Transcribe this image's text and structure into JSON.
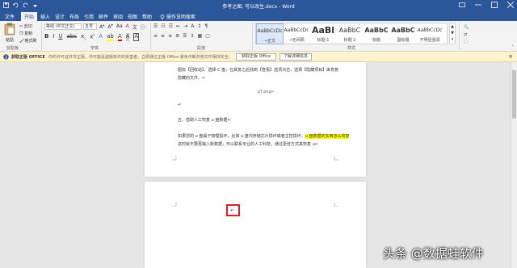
{
  "titlebar": {
    "doc_title": "参考之图, 可以改生.docx - Word"
  },
  "tabs": [
    {
      "label": "文件"
    },
    {
      "label": "开始"
    },
    {
      "label": "插入"
    },
    {
      "label": "设计"
    },
    {
      "label": "布局"
    },
    {
      "label": "引用"
    },
    {
      "label": "邮件"
    },
    {
      "label": "审阅"
    },
    {
      "label": "视图"
    },
    {
      "label": "帮助"
    }
  ],
  "tell_me": "操作说明搜索",
  "ribbon": {
    "paste_label": "粘贴",
    "cut_label": "剪切",
    "copy_label": "复制",
    "format_painter_label": "格式刷",
    "font_name": "等线 (中文正文)",
    "font_size": "五号",
    "groups": {
      "clipboard": "剪贴板",
      "font": "字体",
      "paragraph": "段落",
      "styles": "样式"
    },
    "styles": [
      {
        "sample": "AaBbCcDc",
        "name": "→正文"
      },
      {
        "sample": "AaBbCcDc",
        "name": "→无间隔"
      },
      {
        "sample": "AaBl",
        "name": "标题 1"
      },
      {
        "sample": "AaBbC",
        "name": "标题 2"
      },
      {
        "sample": "AaBbC",
        "name": "标题"
      },
      {
        "sample": "AaBbC",
        "name": "副标题"
      },
      {
        "sample": "AaBbCcDc",
        "name": "不明显强调"
      },
      {
        "sample": "AaBbCcDc",
        "name": "强调"
      }
    ]
  },
  "message_bar": {
    "title": "获取正版 OFFICE",
    "text": "你的许可证并非正版，你可能是盗版软件的受害者。立即通过正版 Office 避免中断并使文件保持安全。",
    "button1": "获取正版 Office",
    "button2": "了解详细信息"
  },
  "document": {
    "line1": "图标【回收站】，选择 C 盘，在其复之后找到【查看】选项点击，选择【隐藏项目】来恢复",
    "line2": "隐藏的文件。↵",
    "image_caption": "pT.png↵",
    "arrow1": "↵",
    "heading5": "五、借助人工恢复 u 盘数据↵",
    "para_a": "如果您的 u 盘属于物理损坏，比如 u 盘内存储芯片损坏或者主控损坏，",
    "para_highlight1": "u 盘数据的东西怎么恢复",
    "para_b": "这时就不要再输入新数据，可以联系专业的人工科技，通过更佳方式来恢复 u↵",
    "cursor_mark": "↵"
  },
  "watermark": "头条 @数据蛙软件"
}
